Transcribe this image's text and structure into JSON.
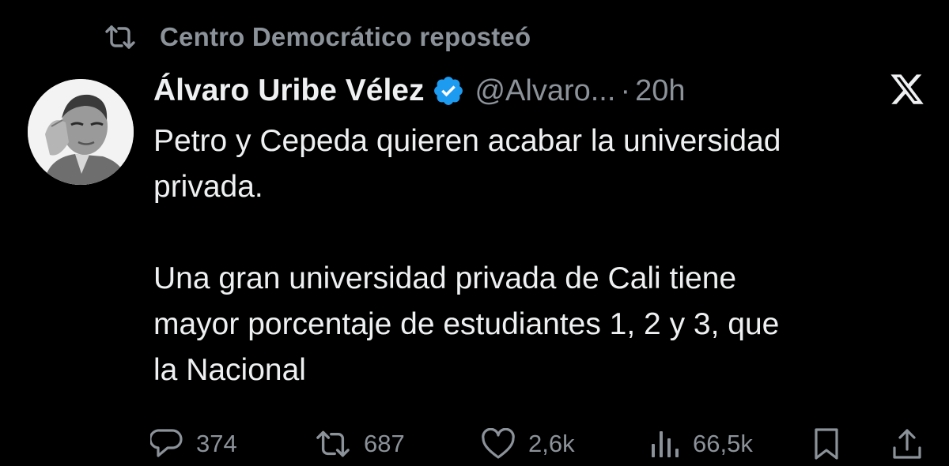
{
  "repost": {
    "icon": "repost-icon",
    "text": "Centro Democrático reposteó"
  },
  "tweet": {
    "avatar": "profile-avatar",
    "display_name": "Álvaro Uribe Vélez",
    "verified_icon": "verified-badge-icon",
    "verified_color": "#1d9bf0",
    "handle": "@Alvaro...",
    "separator": "·",
    "time": "20h",
    "brand_icon": "x-logo-icon",
    "paragraphs": [
      [
        "Petro y Cepeda quieren acabar la universidad",
        "privada."
      ],
      [
        "Una gran universidad privada de Cali tiene",
        "mayor porcentaje de estudiantes 1, 2 y 3, que",
        "la Nacional"
      ]
    ]
  },
  "actions": {
    "replies": {
      "icon": "reply-icon",
      "count": "374"
    },
    "reposts": {
      "icon": "repost-icon",
      "count": "687"
    },
    "likes": {
      "icon": "heart-icon",
      "count": "2,6k"
    },
    "views": {
      "icon": "views-icon",
      "count": "66,5k"
    },
    "bookmark": {
      "icon": "bookmark-icon"
    },
    "share": {
      "icon": "share-icon"
    }
  },
  "colors": {
    "background": "#000000",
    "primary_text": "#eef0f1",
    "secondary_text": "#8b9299"
  }
}
